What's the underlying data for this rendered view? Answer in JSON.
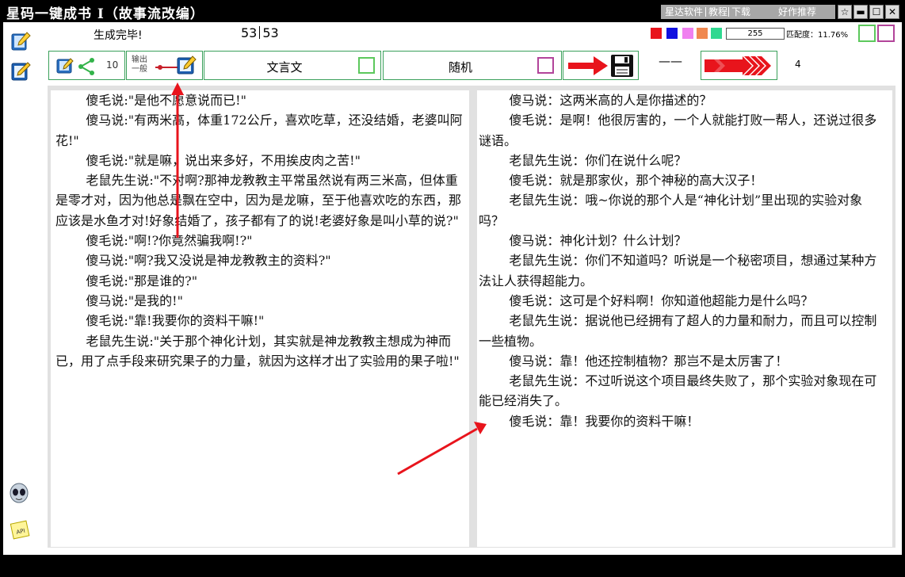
{
  "window": {
    "title": "星码一键成书 I（故事流改编）",
    "links": {
      "software": "星达软件",
      "tutorial": "教程",
      "download": "下载",
      "recommend": "好作推荐"
    },
    "buttons": {
      "star": "☆",
      "minimize": "▬",
      "maximize": "☐",
      "close": "✕"
    }
  },
  "sidebar": {
    "icons": [
      "book-pencil-icon",
      "notebook-edit-icon",
      "alien-face-icon",
      "api-note-icon"
    ],
    "api_text": "API"
  },
  "status": {
    "message": "生成完毕!",
    "current": "53",
    "total": "53"
  },
  "palette": {
    "colors": [
      "#e8141c",
      "#1010e0",
      "#f080f0",
      "#f08850",
      "#30d890"
    ],
    "value": "255",
    "match_label": "匹配度：11.76%",
    "box_colors": [
      "#5cc85c",
      "#b2449a"
    ]
  },
  "toolbar": {
    "share_count": "10",
    "output_label_top": "输出",
    "output_label_bottom": "一般",
    "style_button": "文言文",
    "style_check_color": "#5cc85c",
    "mode_button": "随机",
    "mode_check_color": "#b2449a",
    "separator": "——",
    "step_count": "4",
    "colors": {
      "border": "#3aa05a",
      "arrow": "#e8141c"
    }
  },
  "left_text": [
    "傻毛说:\"是他不愿意说而已!\"",
    "傻马说:\"有两米高，体重172公斤，喜欢吃草，还没结婚，老婆叫阿花!\"",
    "傻毛说:\"就是嘛，说出来多好，不用挨皮肉之苦!\"",
    "老鼠先生说:\"不对啊?那神龙教教主平常虽然说有两三米高，但体重是零才对，因为他总是飘在空中，因为是龙嘛，至于他喜欢吃的东西，那应该是水鱼才对!好象结婚了，孩子都有了的说!老婆好象是叫小草的说?\"",
    "傻毛说:\"啊!?你竟然骗我啊!?\"",
    "傻马说:\"啊?我又没说是神龙教教主的资料?\"",
    "傻毛说:\"那是谁的?\"",
    "傻马说:\"是我的!\"",
    "傻毛说:\"靠!我要你的资料干嘛!\"",
    "老鼠先生说:\"关于那个神化计划，其实就是神龙教教主想成为神而已，用了点手段来研究果子的力量，就因为这样才出了实验用的果子啦!\""
  ],
  "right_text": [
    "傻马说：这两米高的人是你描述的？",
    "傻毛说：是啊！他很厉害的，一个人就能打败一帮人，还说过很多谜语。",
    "老鼠先生说：你们在说什么呢？",
    "傻毛说：就是那家伙，那个神秘的高大汉子！",
    "老鼠先生说：哦~你说的那个人是“神化计划”里出现的实验对象吗？",
    "傻马说：神化计划？什么计划？",
    "老鼠先生说：你们不知道吗？听说是一个秘密项目，想通过某种方法让人获得超能力。",
    "傻毛说：这可是个好料啊！你知道他超能力是什么吗？",
    "老鼠先生说：据说他已经拥有了超人的力量和耐力，而且可以控制一些植物。",
    "傻马说：靠！他还控制植物？那岂不是太厉害了！",
    "老鼠先生说：不过听说这个项目最终失败了，那个实验对象现在可能已经消失了。",
    "傻毛说：靠！我要你的资料干嘛！"
  ]
}
